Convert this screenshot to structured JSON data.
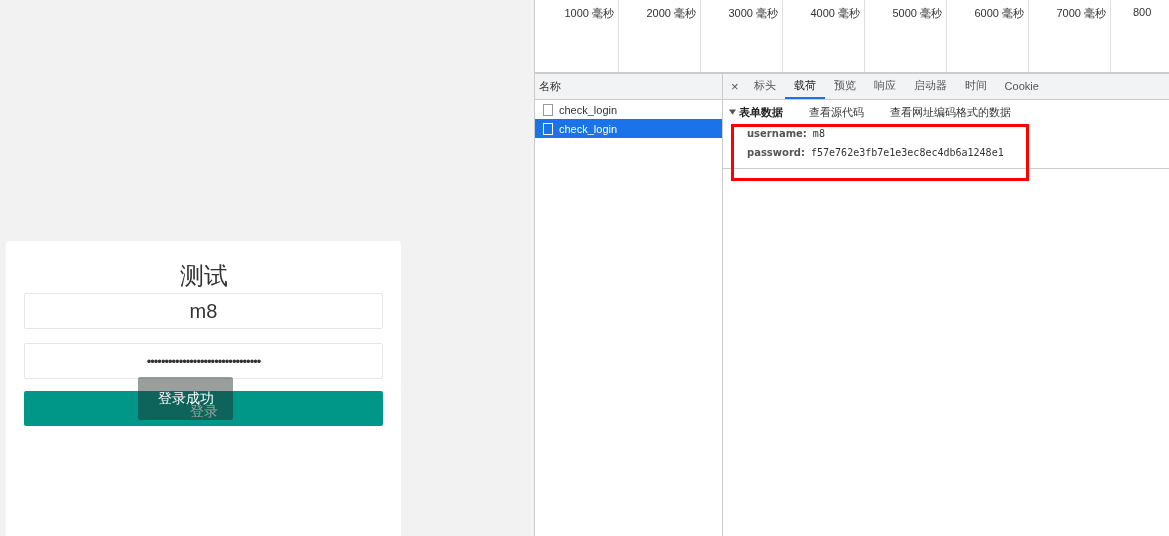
{
  "login_form": {
    "title": "测试",
    "username": "m8",
    "password_mask": "••••••••••••••••••••••••••••••••",
    "submit_label": "登录",
    "toast": "登录成功"
  },
  "devtools": {
    "timeline": {
      "ticks": [
        "1000 毫秒",
        "2000 毫秒",
        "3000 毫秒",
        "4000 毫秒",
        "5000 毫秒",
        "6000 毫秒",
        "7000 毫秒",
        "800"
      ]
    },
    "requests": {
      "header": "名称",
      "rows": [
        {
          "name": "check_login",
          "selected": false
        },
        {
          "name": "check_login",
          "selected": true
        }
      ]
    },
    "detail": {
      "close": "×",
      "tabs": [
        {
          "label": "标头",
          "selected": false
        },
        {
          "label": "载荷",
          "selected": true
        },
        {
          "label": "预览",
          "selected": false
        },
        {
          "label": "响应",
          "selected": false
        },
        {
          "label": "启动器",
          "selected": false
        },
        {
          "label": "时间",
          "selected": false
        },
        {
          "label": "Cookie",
          "selected": false
        }
      ],
      "section": {
        "title": "表单数据",
        "expanded": true,
        "links": [
          "查看源代码",
          "查看网址编码格式的数据"
        ],
        "fields": [
          {
            "key": "username:",
            "value": "m8"
          },
          {
            "key": "password:",
            "value": "f57e762e3fb7e1e3ec8ec4db6a1248e1"
          }
        ],
        "highlighted": true
      }
    }
  }
}
